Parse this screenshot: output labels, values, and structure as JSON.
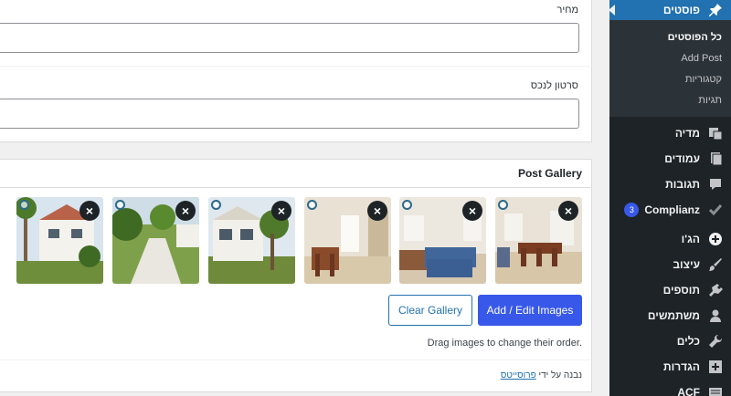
{
  "sidebar": {
    "posts": "פוסטים",
    "submenu": [
      "כל הפוסטים",
      "Add Post",
      "קטגוריות",
      "תגיות"
    ],
    "items": [
      {
        "label": "מדיה",
        "icon": "media-icon"
      },
      {
        "label": "עמודים",
        "icon": "pages-icon"
      },
      {
        "label": "תגובות",
        "icon": "comments-icon"
      },
      {
        "label": "Complianz",
        "icon": "complianz-check-icon",
        "badge": "3"
      },
      {
        "label": "הג'ו",
        "icon": "plus-circle-icon"
      },
      {
        "label": "עיצוב",
        "icon": "appearance-icon"
      },
      {
        "label": "תוספים",
        "icon": "plugins-icon"
      },
      {
        "label": "משתמשים",
        "icon": "users-icon"
      },
      {
        "label": "כלים",
        "icon": "tools-icon"
      },
      {
        "label": "הגדרות",
        "icon": "settings-icon"
      },
      {
        "label": "ACF",
        "icon": "acf-icon"
      }
    ]
  },
  "fields": {
    "price_label": "מחיר",
    "video_label": "סרטון לנכס"
  },
  "gallery": {
    "title": "Post Gallery",
    "remove_glyph": "×",
    "clear_label": "Clear Gallery",
    "add_label": "Add / Edit Images",
    "hint": "Drag images to change their order.",
    "credit_prefix": "נבנה על ידי",
    "credit_link": "פרוסייטס"
  },
  "colors": {
    "sidebar_bg": "#1d2327",
    "accent": "#2271b1",
    "primary_button": "#3858e9"
  }
}
